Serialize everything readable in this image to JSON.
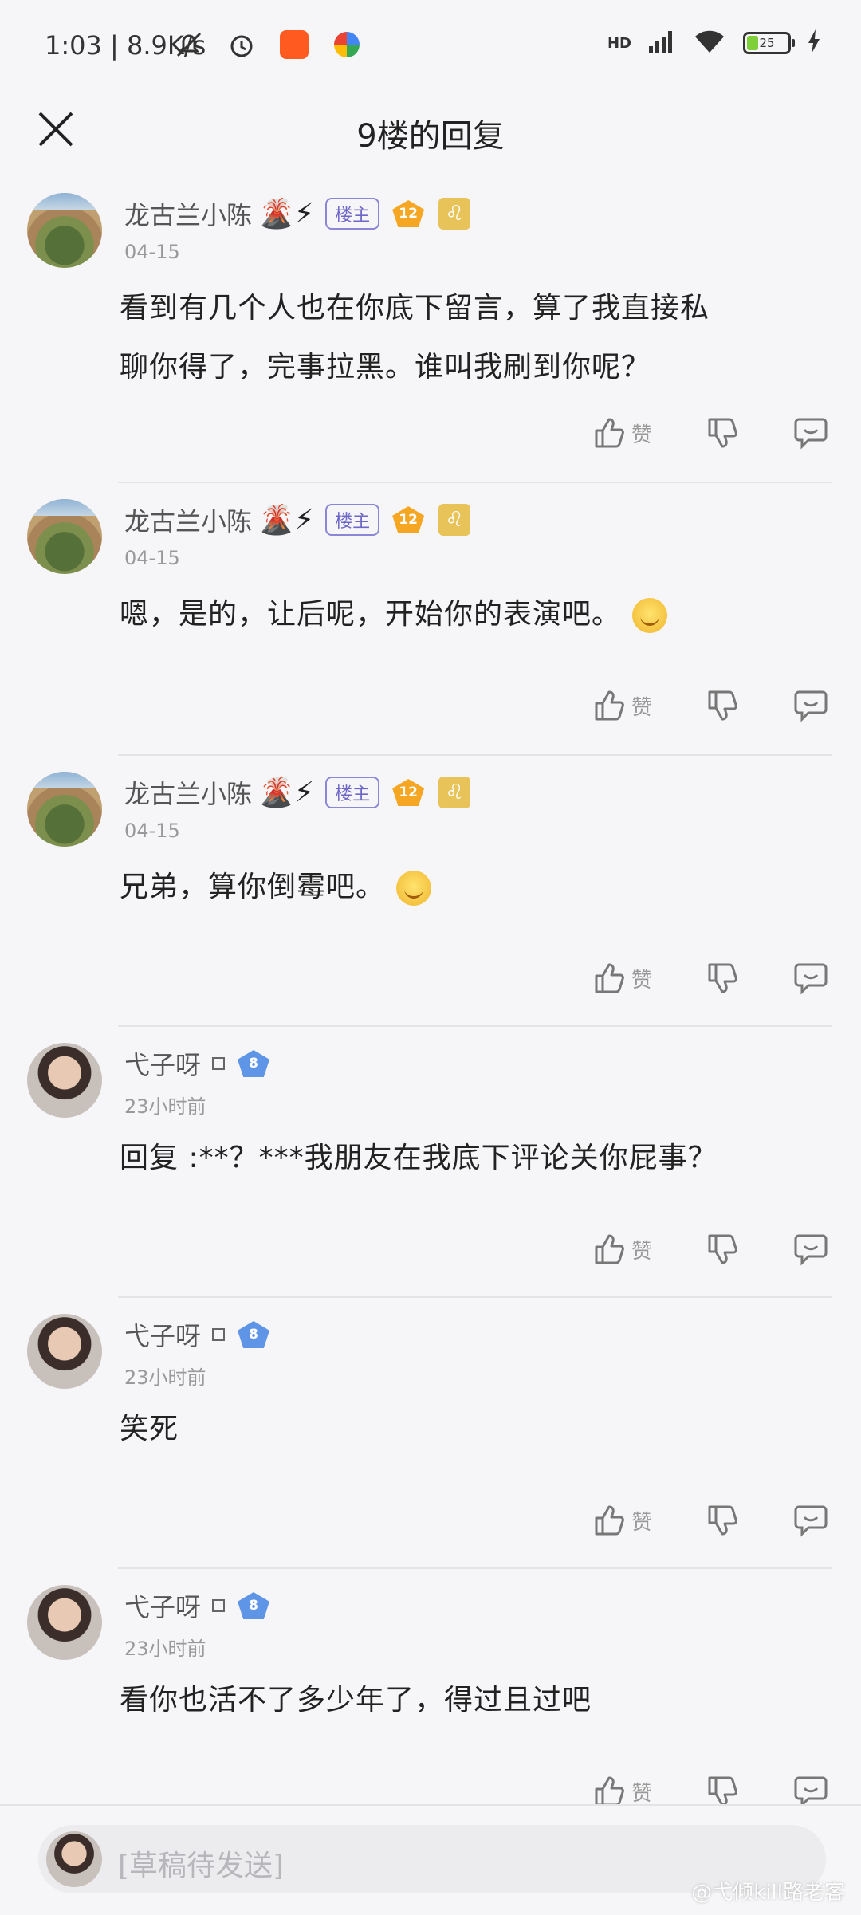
{
  "status_bar": {
    "time": "1:03",
    "speed": "8.9K/s",
    "network": "HD",
    "battery": "25",
    "battery_level": 0.25
  },
  "header": {
    "title": "9楼的回复"
  },
  "replies": [
    {
      "username": "龙古兰小陈",
      "emojis": "🌋⚡",
      "owner_tag": "楼主",
      "level": "12",
      "sign": "♌",
      "time": "04-15",
      "text_line1": "看到有几个人也在你底下留言，算了我直接私",
      "text_line2": "聊你得了，完事拉黑。谁叫我刷到你呢？",
      "like_label": "赞"
    },
    {
      "username": "龙古兰小陈",
      "emojis": "🌋⚡",
      "owner_tag": "楼主",
      "level": "12",
      "sign": "♌",
      "time": "04-15",
      "text": "嗯，是的，让后呢，开始你的表演吧。",
      "like_label": "赞"
    },
    {
      "username": "龙古兰小陈",
      "emojis": "🌋⚡",
      "owner_tag": "楼主",
      "level": "12",
      "sign": "♌",
      "time": "04-15",
      "text": "兄弟，算你倒霉吧。",
      "like_label": "赞"
    },
    {
      "username": "弋子呀",
      "level": "8",
      "time": "23小时前",
      "text": "回复    :**？***我朋友在我底下评论关你屁事？",
      "like_label": "赞"
    },
    {
      "username": "弋子呀",
      "level": "8",
      "time": "23小时前",
      "text": "笑死",
      "like_label": "赞"
    },
    {
      "username": "弋子呀",
      "level": "8",
      "time": "23小时前",
      "text": "看你也活不了多少年了，得过且过吧",
      "like_label": "赞"
    }
  ],
  "bottom_bar": {
    "placeholder": "[草稿待发送]",
    "watermark": "@弋倾kill路老客"
  }
}
